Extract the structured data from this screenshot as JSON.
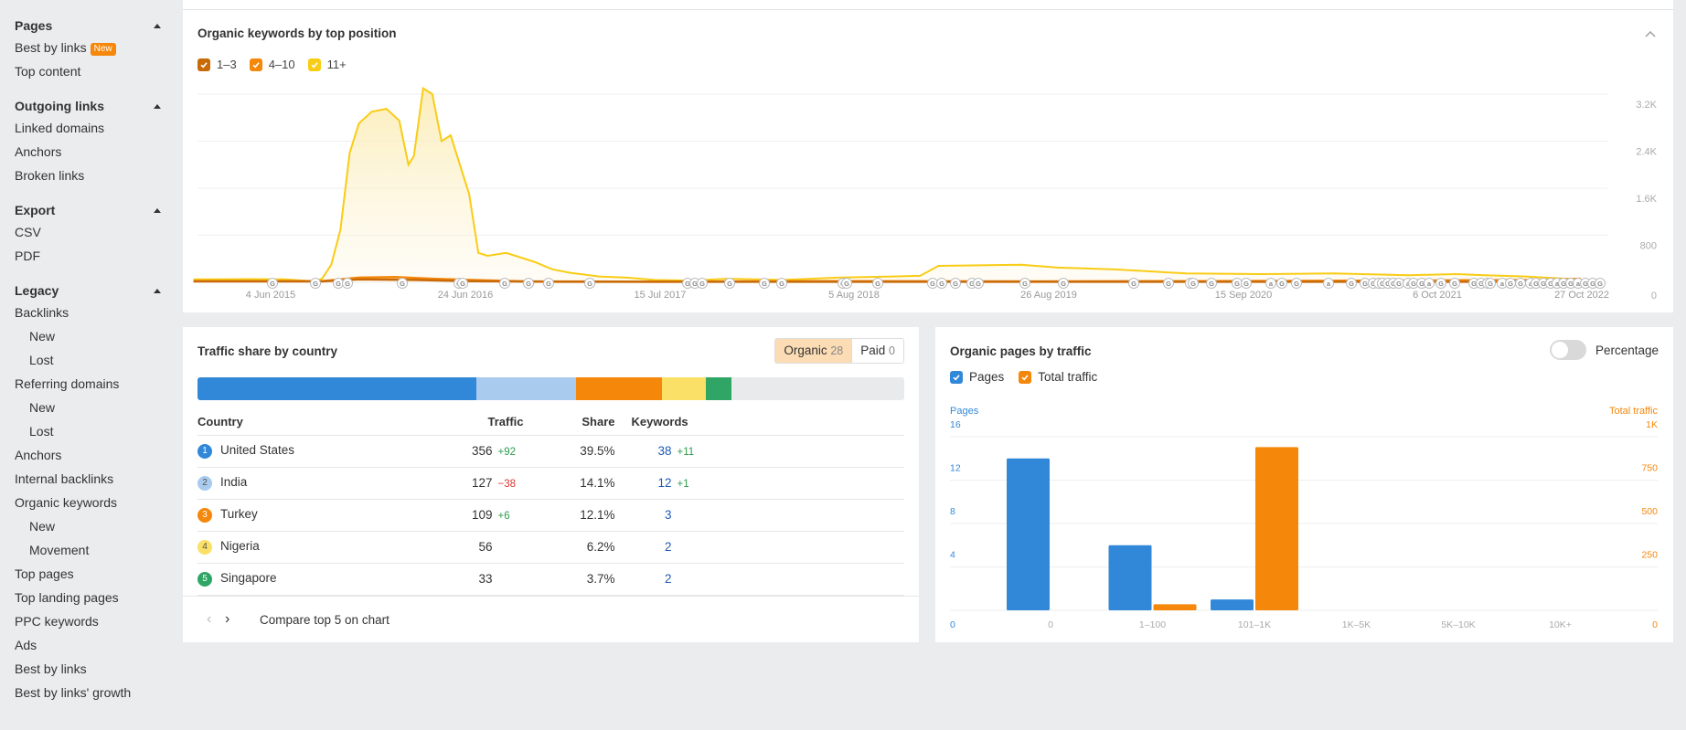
{
  "sidebar": {
    "sections": [
      {
        "title": "Pages",
        "items": [
          {
            "label": "Best by links",
            "badge": "New",
            "sub": false
          },
          {
            "label": "Top content",
            "sub": false
          }
        ]
      },
      {
        "title": "Outgoing links",
        "items": [
          {
            "label": "Linked domains",
            "sub": false
          },
          {
            "label": "Anchors",
            "sub": false
          },
          {
            "label": "Broken links",
            "sub": false
          }
        ]
      },
      {
        "title": "Export",
        "items": [
          {
            "label": "CSV",
            "sub": false
          },
          {
            "label": "PDF",
            "sub": false
          }
        ]
      },
      {
        "title": "Legacy",
        "items": [
          {
            "label": "Backlinks",
            "sub": false
          },
          {
            "label": "New",
            "sub": true
          },
          {
            "label": "Lost",
            "sub": true
          },
          {
            "label": "Referring domains",
            "sub": false
          },
          {
            "label": "New",
            "sub": true
          },
          {
            "label": "Lost",
            "sub": true
          },
          {
            "label": "Anchors",
            "sub": false
          },
          {
            "label": "Internal backlinks",
            "sub": false
          },
          {
            "label": "Organic keywords",
            "sub": false
          },
          {
            "label": "New",
            "sub": true
          },
          {
            "label": "Movement",
            "sub": true
          },
          {
            "label": "Top pages",
            "sub": false
          },
          {
            "label": "Top landing pages",
            "sub": false
          },
          {
            "label": "PPC keywords",
            "sub": false
          },
          {
            "label": "Ads",
            "sub": false
          },
          {
            "label": "Best by links",
            "sub": false
          },
          {
            "label": "Best by links' growth",
            "sub": false
          }
        ]
      }
    ]
  },
  "colors": {
    "pos_1_3": "#c86a08",
    "pos_4_10": "#f5870b",
    "pos_11_plus": "#f9cc16",
    "blue": "#3288d8",
    "light_blue": "#a9cbee",
    "orange": "#f5870b",
    "yellow": "#fae066",
    "green": "#2fa665",
    "gray": "#e9eaeb"
  },
  "keywords_chart": {
    "title": "Organic keywords by top position",
    "legend": [
      {
        "label": "1–3",
        "checked": true,
        "color_key": "pos_1_3"
      },
      {
        "label": "4–10",
        "checked": true,
        "color_key": "pos_4_10"
      },
      {
        "label": "11+",
        "checked": true,
        "color_key": "pos_11_plus"
      }
    ]
  },
  "country": {
    "title": "Traffic share by country",
    "toggle": [
      {
        "label": "Organic",
        "count": "28",
        "active": true
      },
      {
        "label": "Paid",
        "count": "0",
        "active": false
      }
    ],
    "columns": [
      "Country",
      "Traffic",
      "Share",
      "Keywords"
    ],
    "rows": [
      {
        "rank": "1",
        "country": "United States",
        "traffic": "356",
        "traffic_delta": "+92",
        "share": "39.5%",
        "keywords": "38",
        "keywords_delta": "+11",
        "color_key": "blue"
      },
      {
        "rank": "2",
        "country": "India",
        "traffic": "127",
        "traffic_delta": "−38",
        "share": "14.1%",
        "keywords": "12",
        "keywords_delta": "+1",
        "color_key": "light_blue"
      },
      {
        "rank": "3",
        "country": "Turkey",
        "traffic": "109",
        "traffic_delta": "+6",
        "share": "12.1%",
        "keywords": "3",
        "keywords_delta": "",
        "color_key": "orange"
      },
      {
        "rank": "4",
        "country": "Nigeria",
        "traffic": "56",
        "traffic_delta": "",
        "share": "6.2%",
        "keywords": "2",
        "keywords_delta": "",
        "color_key": "yellow"
      },
      {
        "rank": "5",
        "country": "Singapore",
        "traffic": "33",
        "traffic_delta": "",
        "share": "3.7%",
        "keywords": "2",
        "keywords_delta": "",
        "color_key": "green"
      }
    ],
    "share_bar": [
      39.5,
      14.1,
      12.1,
      6.2,
      3.7
    ],
    "compare_label": "Compare top 5 on chart"
  },
  "pages_chart": {
    "title": "Organic pages by traffic",
    "toggle_label": "Percentage",
    "toggle_on": false,
    "legend": [
      {
        "label": "Pages",
        "checked": true
      },
      {
        "label": "Total traffic",
        "checked": true
      }
    ]
  },
  "chart_data": [
    {
      "type": "area",
      "title": "Organic keywords by top position",
      "x_ticks": [
        "4 Jun 2015",
        "24 Jun 2016",
        "15 Jul 2017",
        "5 Aug 2018",
        "26 Aug 2019",
        "15 Sep 2020",
        "6 Oct 2021",
        "27 Oct 2022"
      ],
      "y_ticks": [
        "0",
        "800",
        "1.6K",
        "2.4K",
        "3.2K"
      ],
      "ylim": [
        0,
        3200
      ],
      "xlim": [
        2015.25,
        2022.85
      ],
      "grid": true,
      "series": [
        {
          "name": "11+",
          "color_key": "pos_11_plus",
          "points": [
            [
              2015.0,
              50
            ],
            [
              2015.3,
              55
            ],
            [
              2015.5,
              50
            ],
            [
              2015.6,
              30
            ],
            [
              2015.65,
              20
            ],
            [
              2015.7,
              60
            ],
            [
              2015.75,
              300
            ],
            [
              2015.8,
              900
            ],
            [
              2015.85,
              2200
            ],
            [
              2015.9,
              2700
            ],
            [
              2015.97,
              2900
            ],
            [
              2016.05,
              2950
            ],
            [
              2016.12,
              2750
            ],
            [
              2016.17,
              2000
            ],
            [
              2016.2,
              2150
            ],
            [
              2016.25,
              3300
            ],
            [
              2016.3,
              3200
            ],
            [
              2016.35,
              2400
            ],
            [
              2016.4,
              2500
            ],
            [
              2016.45,
              2000
            ],
            [
              2016.5,
              1500
            ],
            [
              2016.55,
              500
            ],
            [
              2016.6,
              450
            ],
            [
              2016.7,
              500
            ],
            [
              2016.85,
              350
            ],
            [
              2016.95,
              220
            ],
            [
              2017.05,
              160
            ],
            [
              2017.2,
              100
            ],
            [
              2017.35,
              80
            ],
            [
              2017.5,
              40
            ],
            [
              2017.7,
              30
            ],
            [
              2017.9,
              60
            ],
            [
              2018.2,
              40
            ],
            [
              2018.5,
              80
            ],
            [
              2018.8,
              100
            ],
            [
              2018.95,
              110
            ],
            [
              2019.05,
              280
            ],
            [
              2019.5,
              300
            ],
            [
              2019.7,
              250
            ],
            [
              2020.0,
              220
            ],
            [
              2020.4,
              150
            ],
            [
              2020.8,
              140
            ],
            [
              2021.2,
              150
            ],
            [
              2021.6,
              120
            ],
            [
              2021.9,
              140
            ],
            [
              2022.1,
              120
            ],
            [
              2022.4,
              100
            ],
            [
              2022.7,
              60
            ],
            [
              2022.8,
              40
            ]
          ]
        },
        {
          "name": "4–10",
          "color_key": "pos_4_10",
          "points": [
            [
              2015.0,
              20
            ],
            [
              2015.7,
              20
            ],
            [
              2015.9,
              80
            ],
            [
              2016.1,
              90
            ],
            [
              2016.3,
              60
            ],
            [
              2016.5,
              40
            ],
            [
              2016.8,
              15
            ],
            [
              2017.5,
              10
            ],
            [
              2018.5,
              20
            ],
            [
              2019.5,
              15
            ],
            [
              2020.5,
              20
            ],
            [
              2021.5,
              30
            ],
            [
              2022.5,
              40
            ],
            [
              2022.8,
              60
            ]
          ]
        },
        {
          "name": "1–3",
          "color_key": "pos_1_3",
          "points": [
            [
              2015.0,
              15
            ],
            [
              2015.7,
              15
            ],
            [
              2015.9,
              50
            ],
            [
              2016.2,
              40
            ],
            [
              2016.5,
              20
            ],
            [
              2017.0,
              10
            ],
            [
              2018.0,
              10
            ],
            [
              2019.0,
              10
            ],
            [
              2020.0,
              10
            ],
            [
              2021.0,
              10
            ],
            [
              2022.0,
              10
            ],
            [
              2022.8,
              15
            ]
          ]
        }
      ],
      "annotations": "Google update markers (G) and annotation markers (a) along the baseline"
    },
    {
      "type": "bar",
      "title": "Organic pages by traffic",
      "categories": [
        "0",
        "1–100",
        "101–1K",
        "1K–5K",
        "5K–10K",
        "10K+"
      ],
      "series": [
        {
          "name": "Pages",
          "axis": "left",
          "color_key": "blue",
          "values": [
            14,
            6,
            1,
            0,
            0,
            0
          ]
        },
        {
          "name": "Total traffic",
          "axis": "right",
          "color_key": "orange",
          "values": [
            0,
            35,
            940,
            0,
            0,
            0
          ]
        }
      ],
      "ylabel_left": "Pages",
      "ylabel_right": "Total traffic",
      "y_left_ticks": [
        "0",
        "4",
        "8",
        "12",
        "16"
      ],
      "y_right_ticks": [
        "0",
        "250",
        "500",
        "750",
        "1K"
      ],
      "ylim_left": [
        0,
        16
      ],
      "ylim_right": [
        0,
        1000
      ],
      "grid": true
    }
  ]
}
